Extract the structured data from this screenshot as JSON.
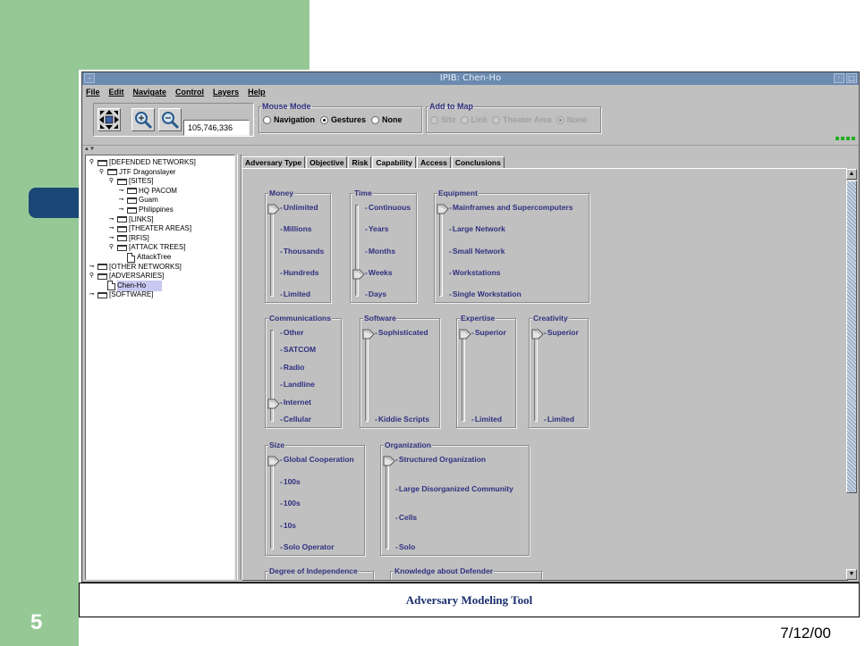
{
  "slide": {
    "number": "5",
    "date": "7/12/00",
    "caption": "Adversary Modeling Tool"
  },
  "window": {
    "title": "IPIB: Chen-Ho",
    "menu": [
      "File",
      "Edit",
      "Navigate",
      "Control",
      "Layers",
      "Help"
    ]
  },
  "toolbar": {
    "coordinate": "105,746,336",
    "mouse_mode": {
      "title": "Mouse Mode",
      "options": [
        "Navigation",
        "Gestures",
        "None"
      ],
      "selected": "Gestures"
    },
    "add_to_map": {
      "title": "Add to Map",
      "options": [
        "Site",
        "Link",
        "Theater Area",
        "None"
      ],
      "selected": "None",
      "enabled": false
    }
  },
  "tree": [
    {
      "label": "[DEFENDED NETWORKS]",
      "depth": 0,
      "handle": "open",
      "icon": "folder"
    },
    {
      "label": "JTF Dragonslayer",
      "depth": 1,
      "handle": "open",
      "icon": "folder"
    },
    {
      "label": "[SITES]",
      "depth": 2,
      "handle": "open",
      "icon": "folder"
    },
    {
      "label": "HQ PACOM",
      "depth": 3,
      "handle": "closed",
      "icon": "folder"
    },
    {
      "label": "Guam",
      "depth": 3,
      "handle": "closed",
      "icon": "folder"
    },
    {
      "label": "Philippines",
      "depth": 3,
      "handle": "closed",
      "icon": "folder"
    },
    {
      "label": "[LINKS]",
      "depth": 2,
      "handle": "closed",
      "icon": "folder"
    },
    {
      "label": "[THEATER AREAS]",
      "depth": 2,
      "handle": "closed",
      "icon": "folder"
    },
    {
      "label": "[RFIS]",
      "depth": 2,
      "handle": "closed",
      "icon": "folder"
    },
    {
      "label": "[ATTACK TREES]",
      "depth": 2,
      "handle": "open",
      "icon": "folder"
    },
    {
      "label": "AttackTree",
      "depth": 3,
      "handle": "none",
      "icon": "doc"
    },
    {
      "label": "[OTHER NETWORKS]",
      "depth": 0,
      "handle": "closed",
      "icon": "folder"
    },
    {
      "label": "[ADVERSARIES]",
      "depth": 0,
      "handle": "open",
      "icon": "folder"
    },
    {
      "label": "Chen-Ho",
      "depth": 1,
      "handle": "none",
      "icon": "doc",
      "selected": true
    },
    {
      "label": "[SOFTWARE]",
      "depth": 0,
      "handle": "closed",
      "icon": "folder"
    }
  ],
  "tabs": [
    "Adversary Type",
    "Objective",
    "Risk",
    "Capability",
    "Access",
    "Conclusions"
  ],
  "active_tab": "Capability",
  "capability": [
    {
      "title": "Money",
      "ticks": [
        "Unlimited",
        "Millions",
        "Thousands",
        "Hundreds",
        "Limited"
      ],
      "value_index": 0
    },
    {
      "title": "Time",
      "ticks": [
        "Continuous",
        "Years",
        "Months",
        "Weeks",
        "Days"
      ],
      "value_index": 3
    },
    {
      "title": "Equipment",
      "ticks": [
        "Mainframes and Supercomputers",
        "Large Network",
        "Small Network",
        "Workstations",
        "Single Workstation"
      ],
      "value_index": 0
    },
    {
      "title": "Communications",
      "ticks": [
        "Other",
        "SATCOM",
        "Radio",
        "Landline",
        "Internet",
        "Cellular"
      ],
      "value_index": 4
    },
    {
      "title": "Software",
      "ticks": [
        "Sophisticated",
        "Kiddie Scripts"
      ],
      "value_index": 0
    },
    {
      "title": "Expertise",
      "ticks": [
        "Superior",
        "Limited"
      ],
      "value_index": 0
    },
    {
      "title": "Creativity",
      "ticks": [
        "Superior",
        "Limited"
      ],
      "value_index": 0
    },
    {
      "title": "Size",
      "ticks": [
        "Global Cooperation",
        "100s",
        "100s",
        "10s",
        "Solo Operator"
      ],
      "value_index": 0
    },
    {
      "title": "Organization",
      "ticks": [
        "Structured Organization",
        "Large Disorganized Community",
        "Cells",
        "Solo"
      ],
      "value_index": 0
    },
    {
      "title": "Degree of Independence",
      "ticks": [],
      "value_index": null
    },
    {
      "title": "Knowledge about Defender",
      "ticks": [],
      "value_index": null
    }
  ]
}
